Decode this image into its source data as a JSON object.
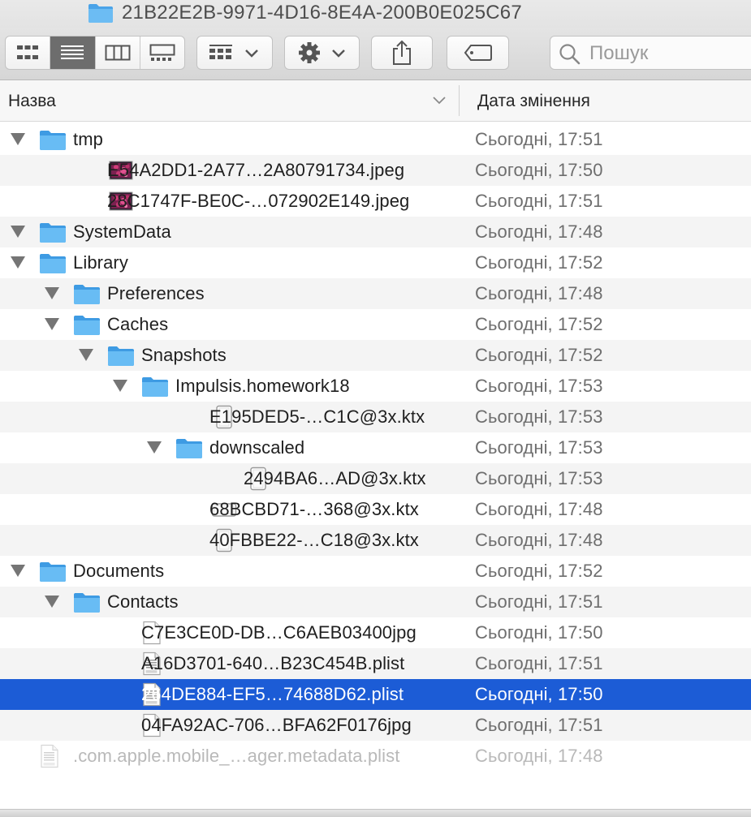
{
  "window": {
    "title": "21B22E2B-9971-4D16-8E4A-200B0E025C67",
    "title_icon": "folder-icon"
  },
  "toolbar": {
    "view_modes": [
      "icon-view-icon",
      "list-view-icon",
      "column-view-icon",
      "gallery-view-icon"
    ],
    "active_view": "list-view-icon",
    "group_icon": "group-by-icon",
    "action_icon": "gear-icon",
    "share_icon": "share-icon",
    "tag_icon": "tag-icon",
    "search_placeholder": "Пошук"
  },
  "columns": {
    "name": "Назва",
    "date": "Дата змінення"
  },
  "files": [
    {
      "name": "tmp",
      "date": "Сьогодні, 17:51",
      "type": "folder",
      "level": 0,
      "expanded": true
    },
    {
      "name": "E54A2DD1-2A77…2A80791734.jpeg",
      "date": "Сьогодні, 17:50",
      "type": "image",
      "level": 1
    },
    {
      "name": "28C1747F-BE0C-…072902E149.jpeg",
      "date": "Сьогодні, 17:51",
      "type": "image",
      "level": 1
    },
    {
      "name": "SystemData",
      "date": "Сьогодні, 17:48",
      "type": "folder",
      "level": 0,
      "expanded": true
    },
    {
      "name": "Library",
      "date": "Сьогодні, 17:52",
      "type": "folder",
      "level": 0,
      "expanded": true
    },
    {
      "name": "Preferences",
      "date": "Сьогодні, 17:48",
      "type": "folder",
      "level": 1,
      "expanded": true
    },
    {
      "name": "Caches",
      "date": "Сьогодні, 17:52",
      "type": "folder",
      "level": 1,
      "expanded": true
    },
    {
      "name": "Snapshots",
      "date": "Сьогодні, 17:52",
      "type": "folder",
      "level": 2,
      "expanded": true
    },
    {
      "name": "Impulsis.homework18",
      "date": "Сьогодні, 17:53",
      "type": "folder",
      "level": 3,
      "expanded": true
    },
    {
      "name": "E195DED5-…C1C@3x.ktx",
      "date": "Сьогодні, 17:53",
      "type": "ktx-portrait",
      "level": 4
    },
    {
      "name": "downscaled",
      "date": "Сьогодні, 17:53",
      "type": "folder",
      "level": 4,
      "expanded": true
    },
    {
      "name": "2494BA6…AD@3x.ktx",
      "date": "Сьогодні, 17:53",
      "type": "ktx-portrait",
      "level": 5
    },
    {
      "name": "68BCBD71-…368@3x.ktx",
      "date": "Сьогодні, 17:48",
      "type": "ktx-landscape",
      "level": 4
    },
    {
      "name": "40FBBE22-…C18@3x.ktx",
      "date": "Сьогодні, 17:48",
      "type": "ktx-portrait",
      "level": 4
    },
    {
      "name": "Documents",
      "date": "Сьогодні, 17:52",
      "type": "folder",
      "level": 0,
      "expanded": true
    },
    {
      "name": "Contacts",
      "date": "Сьогодні, 17:51",
      "type": "folder",
      "level": 1,
      "expanded": true
    },
    {
      "name": "C7E3CE0D-DB…C6AEB03400jpg",
      "date": "Сьогодні, 17:50",
      "type": "doc",
      "level": 2
    },
    {
      "name": "A16D3701-640…B23C454B.plist",
      "date": "Сьогодні, 17:51",
      "type": "plist",
      "level": 2
    },
    {
      "name": "264DE884-EF5…74688D62.plist",
      "date": "Сьогодні, 17:50",
      "type": "plist",
      "level": 2,
      "selected": true
    },
    {
      "name": "04FA92AC-706…BFA62F0176jpg",
      "date": "Сьогодні, 17:51",
      "type": "doc",
      "level": 2
    },
    {
      "name": ".com.apple.mobile_…ager.metadata.plist",
      "date": "Сьогодні, 17:48",
      "type": "plist",
      "level": 0,
      "dimmed": true
    }
  ],
  "colors": {
    "folder": "#5fb4f0",
    "selection": "#1c5cd6",
    "stripe": "#f4f4f4",
    "date_text": "#6e6e6e"
  }
}
